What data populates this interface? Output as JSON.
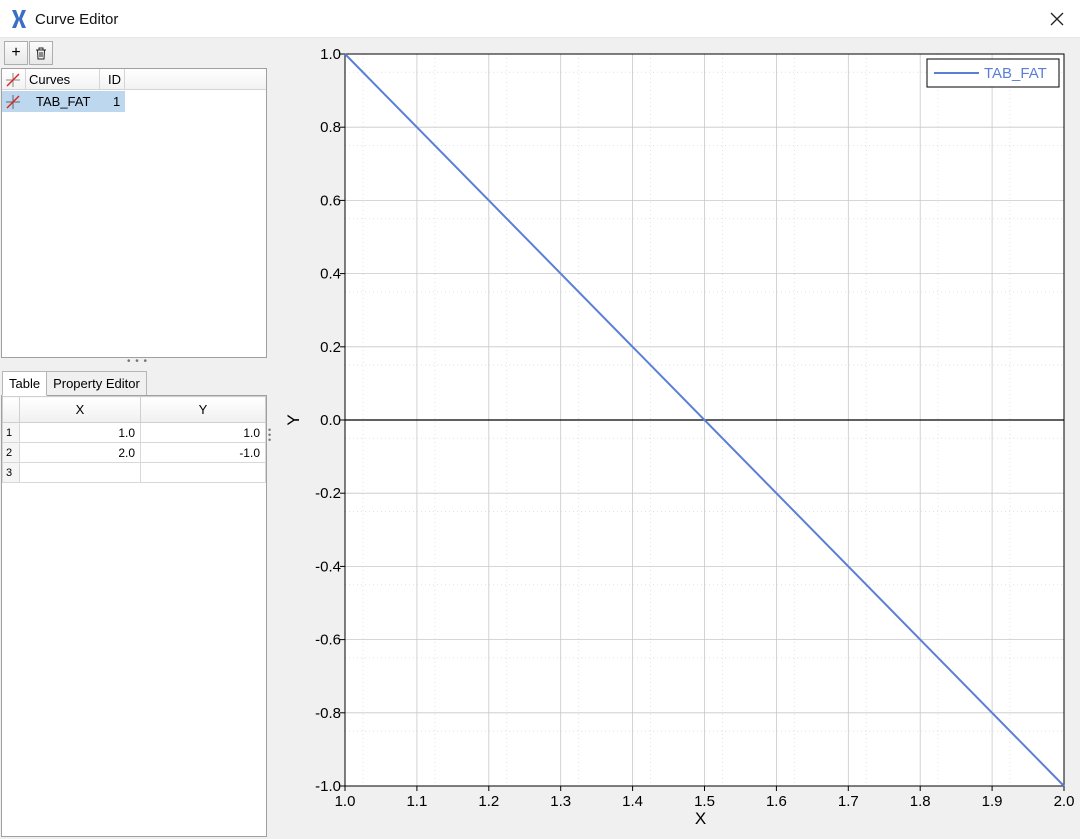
{
  "window": {
    "title": "Curve Editor",
    "app_icon": "curve-editor-logo-icon",
    "close_icon": "close-icon"
  },
  "toolbar": {
    "add_icon": "plus-icon",
    "delete_icon": "trash-icon",
    "add_glyph": "+",
    "delete_glyph": "🗑"
  },
  "curves_list": {
    "columns": [
      "Curves",
      "ID"
    ],
    "rows": [
      {
        "name": "TAB_FAT",
        "id": "1",
        "icon": "curve-icon"
      }
    ]
  },
  "tabs": [
    {
      "label": "Table",
      "active": true
    },
    {
      "label": "Property Editor",
      "active": false
    }
  ],
  "data_table": {
    "columns": [
      "X",
      "Y"
    ],
    "rows": [
      {
        "n": "1",
        "x": "1.0",
        "y": "1.0"
      },
      {
        "n": "2",
        "x": "2.0",
        "y": "-1.0"
      },
      {
        "n": "3",
        "x": "",
        "y": ""
      }
    ]
  },
  "colors": {
    "series": "#5b7fd6",
    "grid": "#c8c8c8",
    "selection": "#bcd7ee"
  },
  "chart_data": {
    "type": "line",
    "xlabel": "X",
    "ylabel": "Y",
    "xlim": [
      1.0,
      2.0
    ],
    "ylim": [
      -1.0,
      1.0
    ],
    "x_ticks": [
      "1.0",
      "1.1",
      "1.2",
      "1.3",
      "1.4",
      "1.5",
      "1.6",
      "1.7",
      "1.8",
      "1.9",
      "2.0"
    ],
    "y_ticks": [
      "1.0",
      "0.8",
      "0.6",
      "0.4",
      "0.2",
      "0.0",
      "-0.2",
      "-0.4",
      "-0.6",
      "-0.8",
      "-1.0"
    ],
    "grid": true,
    "legend_position": "top-right",
    "series": [
      {
        "name": "TAB_FAT",
        "x": [
          1.0,
          2.0
        ],
        "y": [
          1.0,
          -1.0
        ]
      }
    ]
  }
}
